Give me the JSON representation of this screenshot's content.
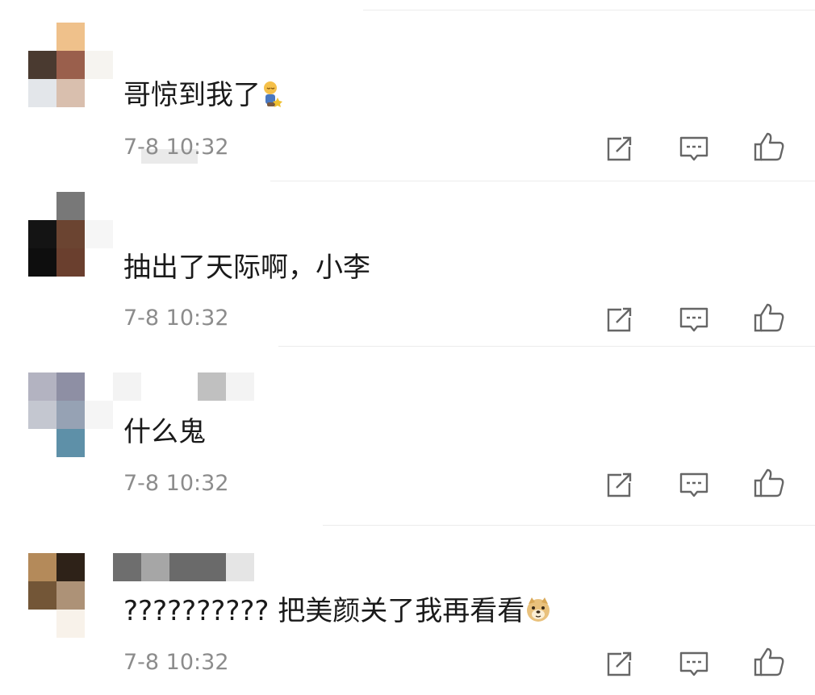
{
  "comments": [
    {
      "text": "哥惊到我了",
      "emoji": "facepalm-emoji",
      "time": "7-8 10:32"
    },
    {
      "text": "抽出了天际啊，小李",
      "time": "7-8 10:32"
    },
    {
      "text": "什么鬼",
      "time": "7-8 10:32"
    },
    {
      "text": "?????????? 把美颜关了我再看看",
      "emoji": "doge-emoji",
      "time": "7-8 10:32"
    }
  ],
  "actions": [
    "share-icon",
    "reply-icon",
    "like-icon"
  ],
  "colors": {
    "text": "#1a1a1a",
    "timestamp": "#8c8c8c",
    "icon": "#666666",
    "divider": "#ececec"
  }
}
